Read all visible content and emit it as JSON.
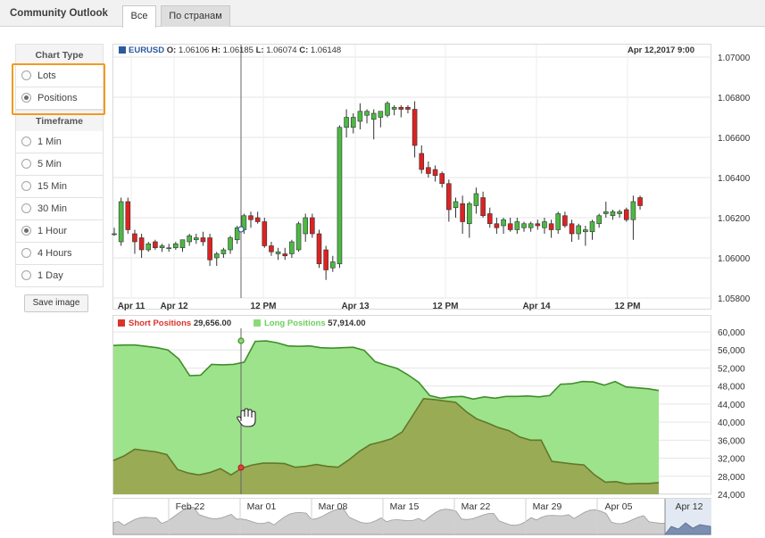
{
  "header": {
    "title": "Community Outlook",
    "tabs": [
      {
        "label": "Все",
        "active": true
      },
      {
        "label": "По странам",
        "active": false
      }
    ]
  },
  "sidebar": {
    "chart_type_heading": "Chart Type",
    "chart_types": [
      {
        "label": "Lots",
        "selected": false
      },
      {
        "label": "Positions",
        "selected": true
      }
    ],
    "timeframe_heading": "Timeframe",
    "timeframes": [
      {
        "label": "1 Min",
        "selected": false
      },
      {
        "label": "5 Min",
        "selected": false
      },
      {
        "label": "15 Min",
        "selected": false
      },
      {
        "label": "30 Min",
        "selected": false
      },
      {
        "label": "1 Hour",
        "selected": true
      },
      {
        "label": "4 Hours",
        "selected": false
      },
      {
        "label": "1 Day",
        "selected": false
      }
    ],
    "save_label": "Save image"
  },
  "price_info": {
    "symbol": "EURUSD",
    "o_label": "O:",
    "o": "1.06106",
    "h_label": "H:",
    "h": "1.06185",
    "l_label": "L:",
    "l": "1.06074",
    "c_label": "C:",
    "c": "1.06148",
    "date": "Apr 12,2017 9:00"
  },
  "positions_legend": {
    "short_label": "Short Positions",
    "short_value": "29,656.00",
    "long_label": "Long Positions",
    "long_value": "57,914.00"
  },
  "colors": {
    "bull": "#4cb944",
    "bear": "#dd2222",
    "accent": "#2c5aa0",
    "long_fill": "#9de38c",
    "long_line": "#3f8f2a",
    "short_fill": "#9aab55",
    "short_line": "#62782a",
    "highlight": "#f39a1f"
  },
  "chart_data": [
    {
      "type": "candlestick",
      "title": "EURUSD",
      "ylim": [
        1.058,
        1.0705
      ],
      "y_ticks": [
        "1.07000",
        "1.06800",
        "1.06600",
        "1.06400",
        "1.06200",
        "1.06000",
        "1.05800"
      ],
      "x_ticks": [
        "Apr 11",
        "Apr 12",
        "12 PM",
        "Apr 13",
        "12 PM",
        "Apr 14",
        "12 PM"
      ],
      "candles": [
        {
          "o": 1.0612,
          "h": 1.0615,
          "l": 1.0611,
          "c": 1.0612
        },
        {
          "o": 1.0608,
          "h": 1.063,
          "l": 1.0606,
          "c": 1.0628
        },
        {
          "o": 1.0628,
          "h": 1.063,
          "l": 1.0612,
          "c": 1.0614
        },
        {
          "o": 1.0612,
          "h": 1.0614,
          "l": 1.0602,
          "c": 1.0608
        },
        {
          "o": 1.061,
          "h": 1.0612,
          "l": 1.06,
          "c": 1.0604
        },
        {
          "o": 1.0604,
          "h": 1.0608,
          "l": 1.0603,
          "c": 1.0607
        },
        {
          "o": 1.0608,
          "h": 1.0609,
          "l": 1.0604,
          "c": 1.0605
        },
        {
          "o": 1.0605,
          "h": 1.0607,
          "l": 1.0603,
          "c": 1.0606
        },
        {
          "o": 1.0605,
          "h": 1.0607,
          "l": 1.0603,
          "c": 1.0605
        },
        {
          "o": 1.0605,
          "h": 1.0608,
          "l": 1.0604,
          "c": 1.0607
        },
        {
          "o": 1.0605,
          "h": 1.0609,
          "l": 1.0603,
          "c": 1.0609
        },
        {
          "o": 1.0608,
          "h": 1.0612,
          "l": 1.0606,
          "c": 1.0611
        },
        {
          "o": 1.0609,
          "h": 1.0612,
          "l": 1.0607,
          "c": 1.061
        },
        {
          "o": 1.061,
          "h": 1.0613,
          "l": 1.0606,
          "c": 1.0608
        },
        {
          "o": 1.061,
          "h": 1.0612,
          "l": 1.0596,
          "c": 1.0599
        },
        {
          "o": 1.06,
          "h": 1.0603,
          "l": 1.0596,
          "c": 1.0602
        },
        {
          "o": 1.0602,
          "h": 1.0605,
          "l": 1.06,
          "c": 1.0604
        },
        {
          "o": 1.0604,
          "h": 1.0611,
          "l": 1.0602,
          "c": 1.061
        },
        {
          "o": 1.0609,
          "h": 1.0616,
          "l": 1.0607,
          "c": 1.0615
        },
        {
          "o": 1.0614,
          "h": 1.0622,
          "l": 1.0612,
          "c": 1.0621
        },
        {
          "o": 1.0621,
          "h": 1.0623,
          "l": 1.0615,
          "c": 1.0619
        },
        {
          "o": 1.062,
          "h": 1.0623,
          "l": 1.0617,
          "c": 1.0618
        },
        {
          "o": 1.0618,
          "h": 1.062,
          "l": 1.0605,
          "c": 1.0606
        },
        {
          "o": 1.0606,
          "h": 1.0608,
          "l": 1.0601,
          "c": 1.0603
        },
        {
          "o": 1.0602,
          "h": 1.0605,
          "l": 1.0599,
          "c": 1.0603
        },
        {
          "o": 1.0602,
          "h": 1.0605,
          "l": 1.0599,
          "c": 1.0601
        },
        {
          "o": 1.0602,
          "h": 1.0609,
          "l": 1.06,
          "c": 1.0608
        },
        {
          "o": 1.0604,
          "h": 1.0618,
          "l": 1.0603,
          "c": 1.0617
        },
        {
          "o": 1.0612,
          "h": 1.0622,
          "l": 1.0608,
          "c": 1.062
        },
        {
          "o": 1.062,
          "h": 1.0622,
          "l": 1.061,
          "c": 1.0612
        },
        {
          "o": 1.0612,
          "h": 1.0614,
          "l": 1.0595,
          "c": 1.0597
        },
        {
          "o": 1.0604,
          "h": 1.0606,
          "l": 1.0589,
          "c": 1.0594
        },
        {
          "o": 1.0595,
          "h": 1.0601,
          "l": 1.0593,
          "c": 1.0598
        },
        {
          "o": 1.0597,
          "h": 1.0666,
          "l": 1.0595,
          "c": 1.0665
        },
        {
          "o": 1.0665,
          "h": 1.0674,
          "l": 1.066,
          "c": 1.067
        },
        {
          "o": 1.0665,
          "h": 1.0672,
          "l": 1.0662,
          "c": 1.067
        },
        {
          "o": 1.0668,
          "h": 1.0677,
          "l": 1.0664,
          "c": 1.0673
        },
        {
          "o": 1.0671,
          "h": 1.0674,
          "l": 1.0667,
          "c": 1.0673
        },
        {
          "o": 1.0669,
          "h": 1.0674,
          "l": 1.0659,
          "c": 1.0672
        },
        {
          "o": 1.067,
          "h": 1.0673,
          "l": 1.0665,
          "c": 1.0673
        },
        {
          "o": 1.0671,
          "h": 1.0678,
          "l": 1.067,
          "c": 1.0677
        },
        {
          "o": 1.0674,
          "h": 1.0676,
          "l": 1.0671,
          "c": 1.0675
        },
        {
          "o": 1.0675,
          "h": 1.0676,
          "l": 1.067,
          "c": 1.0674
        },
        {
          "o": 1.0675,
          "h": 1.0676,
          "l": 1.0672,
          "c": 1.0674
        },
        {
          "o": 1.0674,
          "h": 1.0678,
          "l": 1.065,
          "c": 1.0656
        },
        {
          "o": 1.0652,
          "h": 1.0656,
          "l": 1.0642,
          "c": 1.0644
        },
        {
          "o": 1.0645,
          "h": 1.0648,
          "l": 1.064,
          "c": 1.0642
        },
        {
          "o": 1.0644,
          "h": 1.0646,
          "l": 1.0638,
          "c": 1.0641
        },
        {
          "o": 1.0642,
          "h": 1.0643,
          "l": 1.0635,
          "c": 1.0637
        },
        {
          "o": 1.0637,
          "h": 1.0639,
          "l": 1.0618,
          "c": 1.0624
        },
        {
          "o": 1.0625,
          "h": 1.063,
          "l": 1.062,
          "c": 1.0628
        },
        {
          "o": 1.0627,
          "h": 1.0631,
          "l": 1.0612,
          "c": 1.0618
        },
        {
          "o": 1.0617,
          "h": 1.0628,
          "l": 1.061,
          "c": 1.0627
        },
        {
          "o": 1.0626,
          "h": 1.0635,
          "l": 1.0622,
          "c": 1.0632
        },
        {
          "o": 1.063,
          "h": 1.0633,
          "l": 1.062,
          "c": 1.0621
        },
        {
          "o": 1.0622,
          "h": 1.0625,
          "l": 1.0615,
          "c": 1.0617
        },
        {
          "o": 1.0617,
          "h": 1.062,
          "l": 1.0612,
          "c": 1.0615
        },
        {
          "o": 1.0616,
          "h": 1.062,
          "l": 1.0612,
          "c": 1.0619
        },
        {
          "o": 1.0617,
          "h": 1.062,
          "l": 1.0613,
          "c": 1.0614
        },
        {
          "o": 1.0614,
          "h": 1.062,
          "l": 1.0612,
          "c": 1.0618
        },
        {
          "o": 1.0615,
          "h": 1.0618,
          "l": 1.0613,
          "c": 1.0617
        },
        {
          "o": 1.0615,
          "h": 1.0618,
          "l": 1.0613,
          "c": 1.0617
        },
        {
          "o": 1.0617,
          "h": 1.0619,
          "l": 1.0614,
          "c": 1.0616
        },
        {
          "o": 1.0615,
          "h": 1.062,
          "l": 1.0612,
          "c": 1.0618
        },
        {
          "o": 1.0617,
          "h": 1.0619,
          "l": 1.061,
          "c": 1.0614
        },
        {
          "o": 1.0614,
          "h": 1.0623,
          "l": 1.0612,
          "c": 1.0622
        },
        {
          "o": 1.0621,
          "h": 1.0623,
          "l": 1.0615,
          "c": 1.0616
        },
        {
          "o": 1.0617,
          "h": 1.0619,
          "l": 1.0608,
          "c": 1.0612
        },
        {
          "o": 1.0612,
          "h": 1.0617,
          "l": 1.0609,
          "c": 1.0616
        },
        {
          "o": 1.0613,
          "h": 1.0616,
          "l": 1.0606,
          "c": 1.0614
        },
        {
          "o": 1.0613,
          "h": 1.0619,
          "l": 1.0609,
          "c": 1.0618
        },
        {
          "o": 1.0617,
          "h": 1.0622,
          "l": 1.0615,
          "c": 1.0621
        },
        {
          "o": 1.0622,
          "h": 1.0628,
          "l": 1.062,
          "c": 1.0623
        },
        {
          "o": 1.0621,
          "h": 1.0624,
          "l": 1.0619,
          "c": 1.0623
        },
        {
          "o": 1.0622,
          "h": 1.0624,
          "l": 1.062,
          "c": 1.0623
        },
        {
          "o": 1.0624,
          "h": 1.0625,
          "l": 1.0618,
          "c": 1.0619
        },
        {
          "o": 1.0619,
          "h": 1.0631,
          "l": 1.0609,
          "c": 1.0628
        },
        {
          "o": 1.063,
          "h": 1.0631,
          "l": 1.0624,
          "c": 1.0626
        }
      ]
    },
    {
      "type": "area",
      "ylim": [
        24000,
        60000
      ],
      "y_ticks": [
        "60,000",
        "56,000",
        "52,000",
        "48,000",
        "44,000",
        "40,000",
        "36,000",
        "32,000",
        "28,000",
        "24,000"
      ],
      "series": [
        {
          "name": "Long Positions",
          "values": [
            57000,
            57100,
            57100,
            56800,
            56500,
            56000,
            54000,
            50300,
            50400,
            52800,
            52700,
            52800,
            53300,
            57900,
            58000,
            57600,
            56900,
            56800,
            56900,
            56500,
            56400,
            56500,
            56600,
            55900,
            53400,
            52600,
            51900,
            50500,
            48800,
            45900,
            45300,
            45600,
            45700,
            45100,
            45600,
            45300,
            45700,
            45700,
            45800,
            45600,
            45900,
            48400,
            48500,
            49000,
            48900,
            48200,
            49000,
            47800,
            47600,
            47400,
            47000
          ]
        },
        {
          "name": "Short Positions",
          "values": [
            31500,
            32500,
            34000,
            33700,
            33400,
            32800,
            29500,
            28700,
            28300,
            28800,
            29700,
            28300,
            29800,
            30500,
            30900,
            30900,
            30800,
            30000,
            30200,
            30600,
            30200,
            30000,
            31600,
            33500,
            35000,
            35600,
            36300,
            37800,
            41500,
            45200,
            45000,
            44700,
            44400,
            42300,
            40700,
            39800,
            38800,
            38100,
            36700,
            36000,
            36000,
            31300,
            31000,
            30700,
            30500,
            28300,
            26700,
            26800,
            26300,
            26400,
            26400,
            26600
          ]
        }
      ]
    },
    {
      "type": "area",
      "x_ticks": [
        "Feb 22",
        "Mar 01",
        "Mar 08",
        "Mar 15",
        "Mar 22",
        "Mar 29",
        "Apr 05",
        "Apr 12"
      ]
    }
  ]
}
